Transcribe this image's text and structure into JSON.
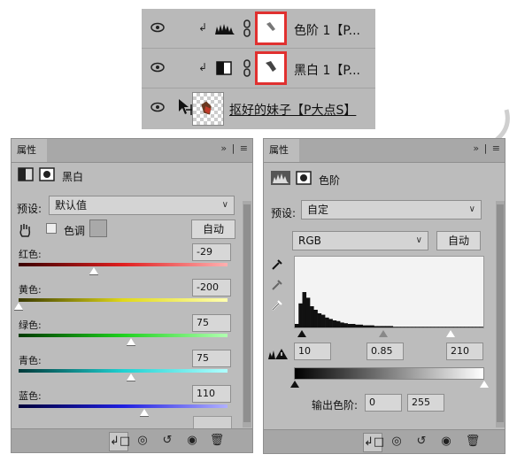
{
  "layers": [
    {
      "name": "色阶 1【P...",
      "clip_glyph": "↲",
      "adj_icon": "levels-icon",
      "mask_highlighted": true
    },
    {
      "name": "黑白 1【P...",
      "clip_glyph": "↲",
      "adj_icon": "black-white-icon",
      "mask_highlighted": true
    },
    {
      "name": "抠好的妹子【P大点S】",
      "clip_glyph": "",
      "adj_icon": "",
      "mask_highlighted": false
    }
  ],
  "bw_panel": {
    "tab": "属性",
    "title": "黑白",
    "preset_label": "预设:",
    "preset_value": "默认值",
    "tint_label": "色调",
    "auto_label": "自动",
    "sliders": [
      {
        "label": "红色:",
        "value": "-29",
        "gradient": "linear-gradient(90deg,#3a0000,#e01f1f,#ffb0b0)",
        "pos": 0.36
      },
      {
        "label": "黄色:",
        "value": "-200",
        "gradient": "linear-gradient(90deg,#3a3a00,#e0d81a,#ffffb0)",
        "pos": 0.0
      },
      {
        "label": "绿色:",
        "value": "75",
        "gradient": "linear-gradient(90deg,#003a00,#1fd11f,#b0ffb0)",
        "pos": 0.54
      },
      {
        "label": "青色:",
        "value": "75",
        "gradient": "linear-gradient(90deg,#003a3a,#1fd1d1,#b0ffff)",
        "pos": 0.54
      },
      {
        "label": "蓝色:",
        "value": "110",
        "gradient": "linear-gradient(90deg,#00003a,#1f1fe0,#b0b0ff)",
        "pos": 0.6
      }
    ]
  },
  "levels_panel": {
    "tab": "属性",
    "title": "色阶",
    "preset_label": "预设:",
    "preset_value": "自定",
    "channel": "RGB",
    "auto_label": "自动",
    "input_black": "10",
    "input_gamma": "0.85",
    "input_white": "210",
    "output_label": "输出色阶:",
    "output_black": "0",
    "output_white": "255"
  },
  "histogram": [
    0.05,
    0.34,
    0.5,
    0.42,
    0.3,
    0.25,
    0.2,
    0.18,
    0.14,
    0.12,
    0.1,
    0.09,
    0.07,
    0.06,
    0.05,
    0.05,
    0.04,
    0.04,
    0.03,
    0.03,
    0.03,
    0.02,
    0.02,
    0.02,
    0.02,
    0.02,
    0.01,
    0.01,
    0.01,
    0.01,
    0.01,
    0.01,
    0.01,
    0.01,
    0.01,
    0.01,
    0.01,
    0.01,
    0.01,
    0.01,
    0.01,
    0.01,
    0.01,
    0.01,
    0.01,
    0.01,
    0.01,
    0.01,
    0.01,
    0.01
  ],
  "colors": {
    "mask_highlight": "#e0302f",
    "panel_bg": "#bcbcbc",
    "layers_bg": "#b9b9b9"
  }
}
